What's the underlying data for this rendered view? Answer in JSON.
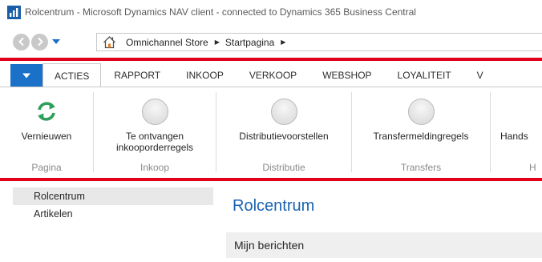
{
  "window": {
    "title": "Rolcentrum - Microsoft Dynamics NAV client - connected to Dynamics 365 Business Central"
  },
  "address_bar": {
    "breadcrumbs": [
      {
        "label": "Omnichannel Store"
      },
      {
        "label": "Startpagina"
      }
    ]
  },
  "ribbon": {
    "tabs": [
      {
        "label": "ACTIES",
        "active": true
      },
      {
        "label": "RAPPORT"
      },
      {
        "label": "INKOOP"
      },
      {
        "label": "VERKOOP"
      },
      {
        "label": "WEBSHOP"
      },
      {
        "label": "LOYALITEIT"
      },
      {
        "label": "V"
      }
    ],
    "groups": [
      {
        "label": "Pagina",
        "buttons": [
          {
            "label_line1": "Vernieuwen",
            "label_line2": "",
            "icon": "refresh-icon"
          }
        ]
      },
      {
        "label": "Inkoop",
        "buttons": [
          {
            "label_line1": "Te ontvangen",
            "label_line2": "inkooporderregels",
            "icon": "placeholder-circle-icon"
          }
        ]
      },
      {
        "label": "Distributie",
        "buttons": [
          {
            "label_line1": "Distributievoorstellen",
            "label_line2": "",
            "icon": "placeholder-circle-icon"
          }
        ]
      },
      {
        "label": "Transfers",
        "buttons": [
          {
            "label_line1": "Transfermeldingregels",
            "label_line2": "",
            "icon": "placeholder-circle-icon"
          }
        ]
      },
      {
        "label": "H",
        "buttons": [
          {
            "label_line1": "Hands",
            "label_line2": "",
            "icon": "placeholder-circle-icon"
          }
        ]
      }
    ]
  },
  "navigation": {
    "items": [
      {
        "label": "Rolcentrum",
        "selected": true
      },
      {
        "label": "Artikelen"
      }
    ]
  },
  "content": {
    "title": "Rolcentrum",
    "section_header": "Mijn berichten"
  },
  "colors": {
    "accent_red": "#e0001b",
    "brand_blue": "#1b70c7",
    "title_blue": "#1b63b0",
    "refresh_green": "#2e9e5b"
  }
}
